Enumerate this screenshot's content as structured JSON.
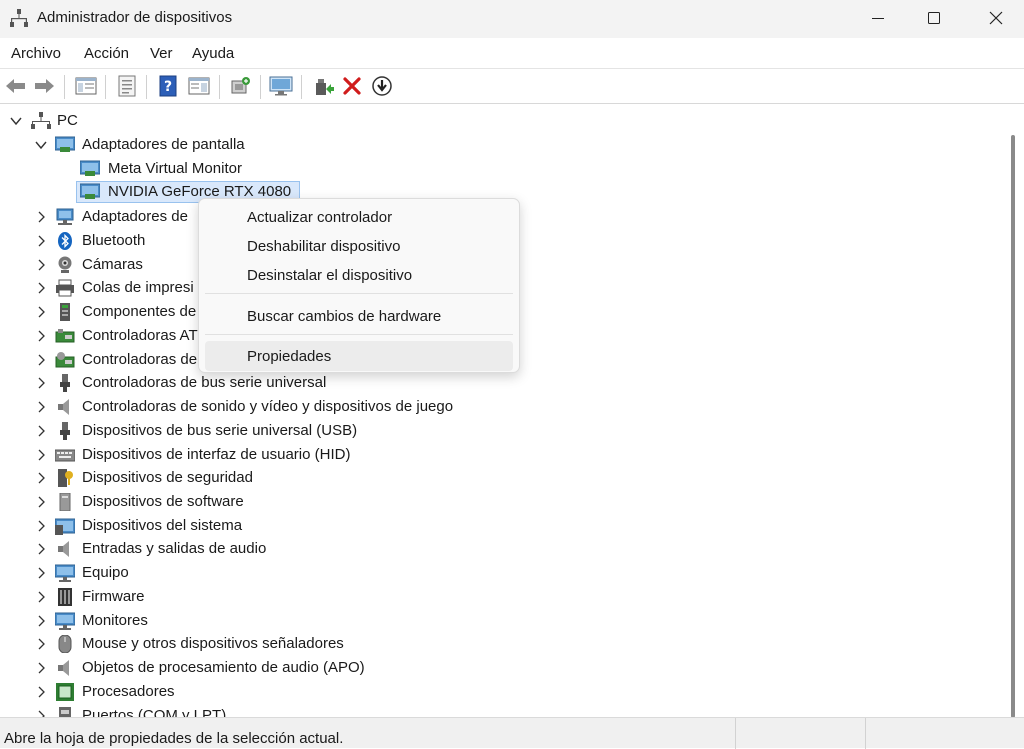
{
  "window": {
    "title": "Administrador de dispositivos",
    "icon": "device-manager-icon"
  },
  "menu": [
    "Archivo",
    "Acción",
    "Ver",
    "Ayuda"
  ],
  "toolbar": {
    "icons": [
      "back-icon",
      "forward-icon",
      "show-hide-tree-icon",
      "properties-icon",
      "help-icon",
      "action-pane-icon",
      "update-driver-icon",
      "scan-hardware-icon",
      "add-legacy-icon",
      "uninstall-icon",
      "disable-device-icon"
    ]
  },
  "tree": {
    "root": "PC",
    "expanded_category": "Adaptadores de pantalla",
    "children": [
      "Meta Virtual Monitor",
      "NVIDIA GeForce RTX 4080"
    ],
    "selected": "NVIDIA GeForce RTX 4080",
    "categories": [
      "Adaptadores de",
      "Bluetooth",
      "Cámaras",
      "Colas de impresi",
      "Componentes de",
      "Controladoras AT",
      "Controladoras de",
      "Controladoras de bus serie universal",
      "Controladoras de sonido y vídeo y dispositivos de juego",
      "Dispositivos de bus serie universal (USB)",
      "Dispositivos de interfaz de usuario (HID)",
      "Dispositivos de seguridad",
      "Dispositivos de software",
      "Dispositivos del sistema",
      "Entradas y salidas de audio",
      "Equipo",
      "Firmware",
      "Monitores",
      "Mouse y otros dispositivos señaladores",
      "Objetos de procesamiento de audio (APO)",
      "Procesadores",
      "Puertos (COM y LPT)"
    ]
  },
  "context_menu": {
    "items": [
      "Actualizar controlador",
      "Deshabilitar dispositivo",
      "Desinstalar el dispositivo",
      "Buscar cambios de hardware",
      "Propiedades"
    ],
    "highlighted": "Propiedades"
  },
  "status": {
    "text": "Abre la hoja de propiedades de la selección actual."
  }
}
